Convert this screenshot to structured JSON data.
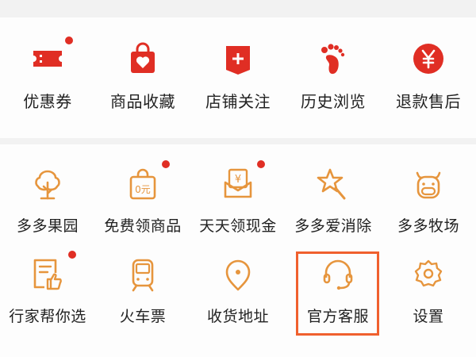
{
  "top_row": [
    {
      "label": "优惠券",
      "icon": "coupon-icon",
      "dot": true
    },
    {
      "label": "商品收藏",
      "icon": "heart-bag-icon",
      "dot": false
    },
    {
      "label": "店铺关注",
      "icon": "store-plus-icon",
      "dot": false
    },
    {
      "label": "历史浏览",
      "icon": "footprint-icon",
      "dot": false
    },
    {
      "label": "退款售后",
      "icon": "yen-circle-icon",
      "dot": false
    }
  ],
  "grid_row1": [
    {
      "label": "多多果园",
      "icon": "tree-icon",
      "dot": false
    },
    {
      "label": "免费领商品",
      "icon": "free-bag-icon",
      "dot": true,
      "icon_text": "0元"
    },
    {
      "label": "天天领现金",
      "icon": "cash-envelope-icon",
      "dot": true,
      "icon_text": "¥"
    },
    {
      "label": "多多爱消除",
      "icon": "star-wand-icon",
      "dot": false
    },
    {
      "label": "多多牧场",
      "icon": "cow-icon",
      "dot": false
    }
  ],
  "grid_row2": [
    {
      "label": "行家帮你选",
      "icon": "checklist-thumb-icon",
      "dot": true
    },
    {
      "label": "火车票",
      "icon": "train-icon",
      "dot": false
    },
    {
      "label": "收货地址",
      "icon": "location-pin-icon",
      "dot": false
    },
    {
      "label": "官方客服",
      "icon": "headset-icon",
      "dot": false,
      "highlighted": true
    },
    {
      "label": "设置",
      "icon": "gear-icon",
      "dot": false
    }
  ],
  "colors": {
    "red": "#e02e24",
    "orange": "#e6953d",
    "highlight": "#f0602e",
    "text": "#222222"
  }
}
